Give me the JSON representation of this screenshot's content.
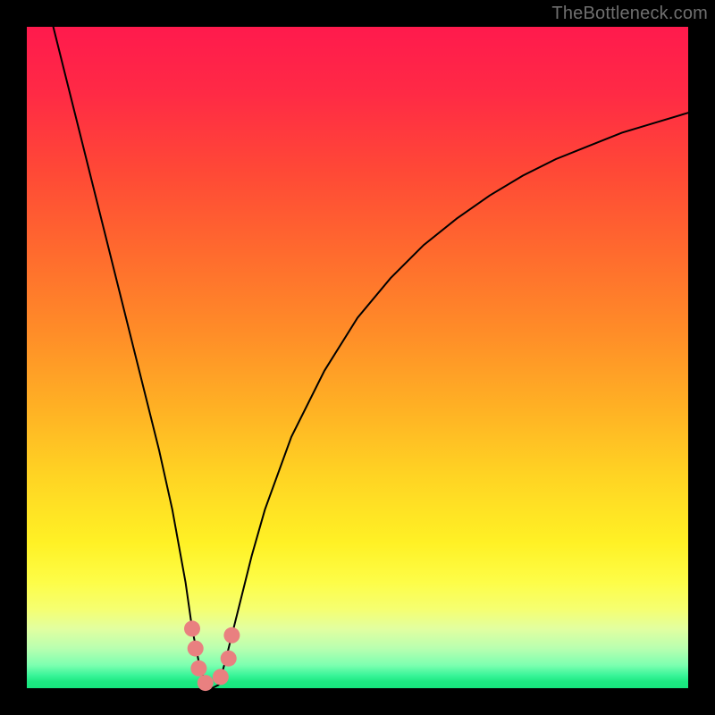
{
  "watermark": "TheBottleneck.com",
  "chart_data": {
    "type": "line",
    "title": "",
    "xlabel": "",
    "ylabel": "",
    "xlim": [
      0,
      100
    ],
    "ylim": [
      0,
      100
    ],
    "series": [
      {
        "name": "bottleneck-curve",
        "x": [
          4,
          6,
          8,
          10,
          12,
          14,
          16,
          18,
          20,
          22,
          24,
          25,
          26,
          27,
          28,
          29,
          30,
          32,
          34,
          36,
          40,
          45,
          50,
          55,
          60,
          65,
          70,
          75,
          80,
          85,
          90,
          95,
          100
        ],
        "values": [
          100,
          92,
          84,
          76,
          68,
          60,
          52,
          44,
          36,
          27,
          16,
          9,
          4,
          0.5,
          0,
          0.5,
          4,
          12,
          20,
          27,
          38,
          48,
          56,
          62,
          67,
          71,
          74.5,
          77.5,
          80,
          82,
          84,
          85.5,
          87
        ]
      }
    ],
    "markers": [
      {
        "x": 25.0,
        "y": 9.0
      },
      {
        "x": 25.5,
        "y": 6.0
      },
      {
        "x": 26.0,
        "y": 3.0
      },
      {
        "x": 27.0,
        "y": 0.8
      },
      {
        "x": 29.3,
        "y": 1.7
      },
      {
        "x": 30.5,
        "y": 4.5
      },
      {
        "x": 31.0,
        "y": 8.0
      }
    ],
    "colors": {
      "curve": "#000000",
      "marker": "#e98080"
    }
  }
}
